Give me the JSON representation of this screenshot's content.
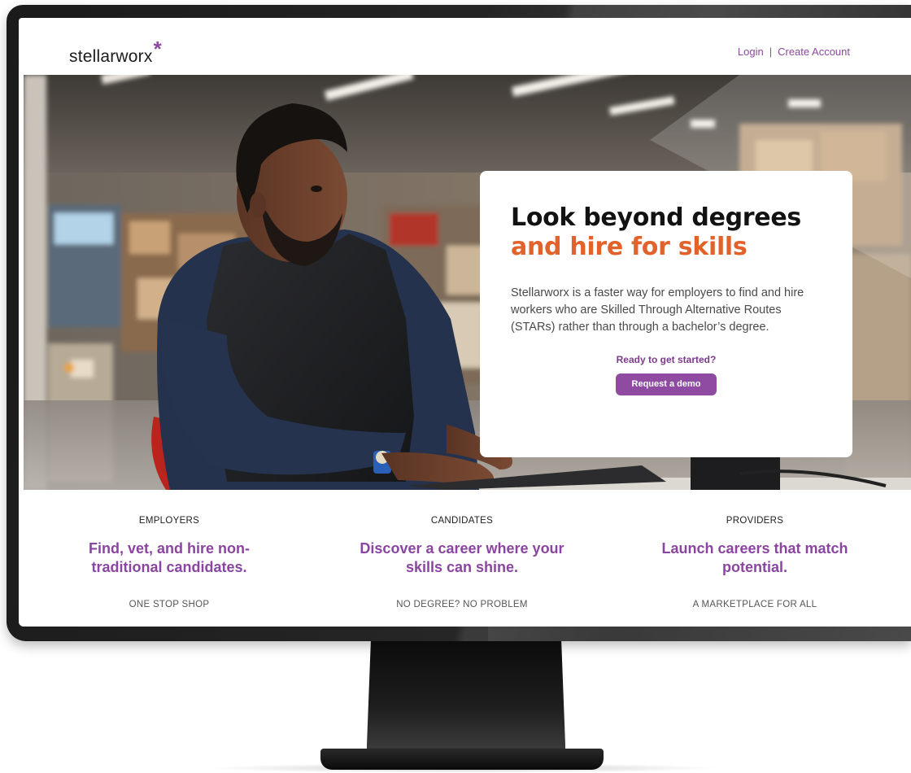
{
  "header": {
    "logo_text": "stellarworx",
    "logo_mark": "*",
    "login_label": "Login",
    "separator": "|",
    "create_account_label": "Create Account"
  },
  "hero": {
    "title_line1": "Look beyond degrees",
    "title_line2": "and hire for skills",
    "description": "Stellarworx is a faster way for employers to find and hire workers who are Skilled Through Alternative Routes (STARs) rather than through a bachelor’s degree.",
    "cta_prompt": "Ready to get started?",
    "cta_button": "Request a demo"
  },
  "features": [
    {
      "label": "EMPLOYERS",
      "headline": "Find, vet, and hire non-traditional candidates.",
      "sub": "ONE STOP SHOP"
    },
    {
      "label": "CANDIDATES",
      "headline": "Discover a career where your skills can shine.",
      "sub": "NO DEGREE? NO PROBLEM"
    },
    {
      "label": "PROVIDERS",
      "headline": "Launch careers that match potential.",
      "sub": "A MARKETPLACE FOR ALL"
    }
  ],
  "colors": {
    "brand_purple": "#8e47a0",
    "accent_orange": "#e2622b",
    "text_dark": "#121212"
  }
}
